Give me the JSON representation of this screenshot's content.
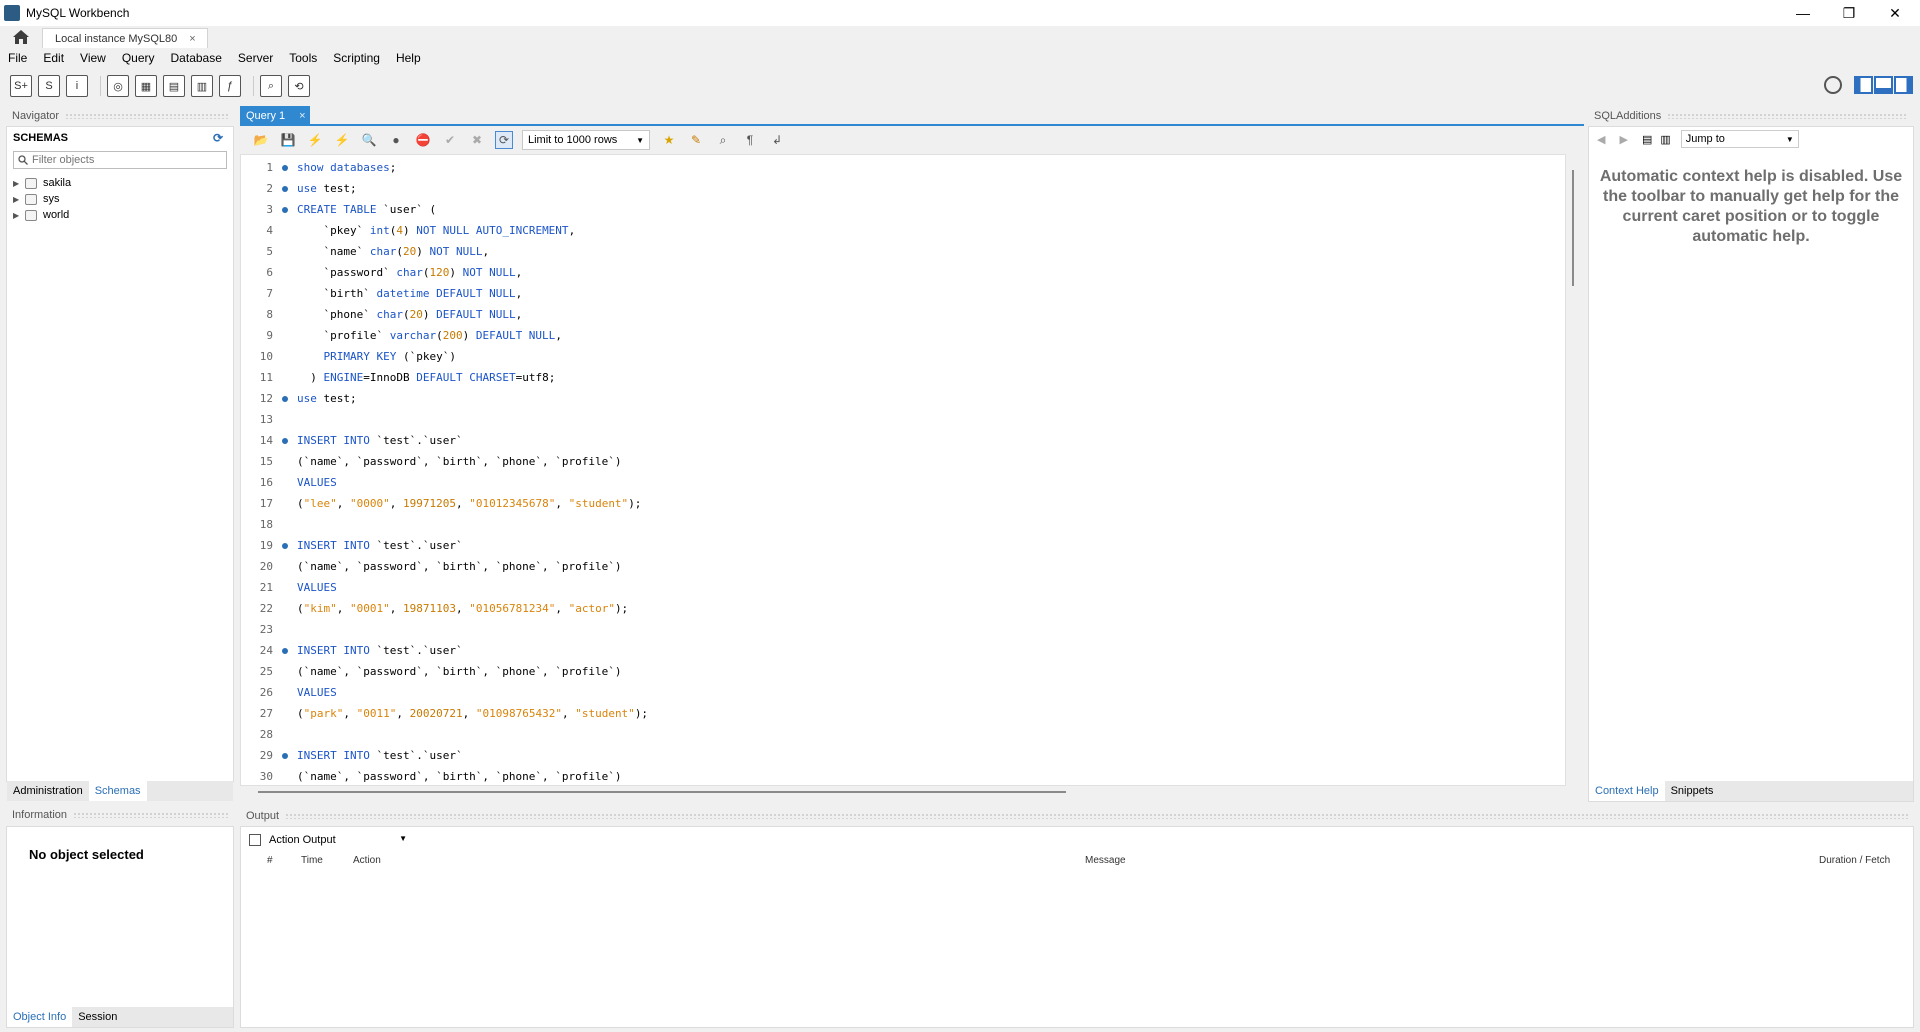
{
  "window": {
    "title": "MySQL Workbench",
    "min": "—",
    "max": "❐",
    "close": "✕"
  },
  "connection_tab": {
    "label": "Local instance MySQL80",
    "close": "×"
  },
  "menu": [
    "File",
    "Edit",
    "View",
    "Query",
    "Database",
    "Server",
    "Tools",
    "Scripting",
    "Help"
  ],
  "navigator": {
    "title": "Navigator",
    "schemas_header": "SCHEMAS",
    "filter_placeholder": "Filter objects",
    "schemas": [
      "sakila",
      "sys",
      "world"
    ],
    "tabs": [
      "Administration",
      "Schemas"
    ]
  },
  "editor": {
    "tab_label": "Query 1",
    "tab_close": "×",
    "limit_label": "Limit to 1000 rows",
    "lines": [
      [
        {
          "t": "show databases",
          "c": "kw"
        },
        {
          "t": ";",
          "c": "plain"
        }
      ],
      [
        {
          "t": "use",
          "c": "kw"
        },
        {
          "t": " test;",
          "c": "plain"
        }
      ],
      [
        {
          "t": "CREATE TABLE",
          "c": "kw"
        },
        {
          "t": " `user` (",
          "c": "plain"
        }
      ],
      [
        {
          "t": "    `pkey` ",
          "c": "plain"
        },
        {
          "t": "int",
          "c": "kw"
        },
        {
          "t": "(",
          "c": "plain"
        },
        {
          "t": "4",
          "c": "num"
        },
        {
          "t": ") ",
          "c": "plain"
        },
        {
          "t": "NOT NULL AUTO_INCREMENT",
          "c": "kw"
        },
        {
          "t": ",",
          "c": "plain"
        }
      ],
      [
        {
          "t": "    `name` ",
          "c": "plain"
        },
        {
          "t": "char",
          "c": "kw"
        },
        {
          "t": "(",
          "c": "plain"
        },
        {
          "t": "20",
          "c": "num"
        },
        {
          "t": ") ",
          "c": "plain"
        },
        {
          "t": "NOT NULL",
          "c": "kw"
        },
        {
          "t": ",",
          "c": "plain"
        }
      ],
      [
        {
          "t": "    `password` ",
          "c": "plain"
        },
        {
          "t": "char",
          "c": "kw"
        },
        {
          "t": "(",
          "c": "plain"
        },
        {
          "t": "120",
          "c": "num"
        },
        {
          "t": ") ",
          "c": "plain"
        },
        {
          "t": "NOT NULL",
          "c": "kw"
        },
        {
          "t": ",",
          "c": "plain"
        }
      ],
      [
        {
          "t": "    `birth` ",
          "c": "plain"
        },
        {
          "t": "datetime DEFAULT NULL",
          "c": "kw"
        },
        {
          "t": ",",
          "c": "plain"
        }
      ],
      [
        {
          "t": "    `phone` ",
          "c": "plain"
        },
        {
          "t": "char",
          "c": "kw"
        },
        {
          "t": "(",
          "c": "plain"
        },
        {
          "t": "20",
          "c": "num"
        },
        {
          "t": ") ",
          "c": "plain"
        },
        {
          "t": "DEFAULT NULL",
          "c": "kw"
        },
        {
          "t": ",",
          "c": "plain"
        }
      ],
      [
        {
          "t": "    `profile` ",
          "c": "plain"
        },
        {
          "t": "varchar",
          "c": "kw"
        },
        {
          "t": "(",
          "c": "plain"
        },
        {
          "t": "200",
          "c": "num"
        },
        {
          "t": ") ",
          "c": "plain"
        },
        {
          "t": "DEFAULT NULL",
          "c": "kw"
        },
        {
          "t": ",",
          "c": "plain"
        }
      ],
      [
        {
          "t": "    ",
          "c": "plain"
        },
        {
          "t": "PRIMARY KEY",
          "c": "kw"
        },
        {
          "t": " (`pkey`)",
          "c": "plain"
        }
      ],
      [
        {
          "t": "  ) ",
          "c": "plain"
        },
        {
          "t": "ENGINE",
          "c": "kw"
        },
        {
          "t": "=InnoDB ",
          "c": "plain"
        },
        {
          "t": "DEFAULT CHARSET",
          "c": "kw"
        },
        {
          "t": "=utf8;",
          "c": "plain"
        }
      ],
      [
        {
          "t": "use",
          "c": "kw"
        },
        {
          "t": " test;",
          "c": "plain"
        }
      ],
      [],
      [
        {
          "t": "INSERT INTO",
          "c": "kw"
        },
        {
          "t": " `test`.`user`",
          "c": "plain"
        }
      ],
      [
        {
          "t": "(`name`, `password`, `birth`, `phone`, `profile`)",
          "c": "plain"
        }
      ],
      [
        {
          "t": "VALUES",
          "c": "kw"
        }
      ],
      [
        {
          "t": "(",
          "c": "plain"
        },
        {
          "t": "\"lee\"",
          "c": "str"
        },
        {
          "t": ", ",
          "c": "plain"
        },
        {
          "t": "\"0000\"",
          "c": "str"
        },
        {
          "t": ", ",
          "c": "plain"
        },
        {
          "t": "19971205",
          "c": "num"
        },
        {
          "t": ", ",
          "c": "plain"
        },
        {
          "t": "\"01012345678\"",
          "c": "str"
        },
        {
          "t": ", ",
          "c": "plain"
        },
        {
          "t": "\"student\"",
          "c": "str"
        },
        {
          "t": ");",
          "c": "plain"
        }
      ],
      [],
      [
        {
          "t": "INSERT INTO",
          "c": "kw"
        },
        {
          "t": " `test`.`user`",
          "c": "plain"
        }
      ],
      [
        {
          "t": "(`name`, `password`, `birth`, `phone`, `profile`)",
          "c": "plain"
        }
      ],
      [
        {
          "t": "VALUES",
          "c": "kw"
        }
      ],
      [
        {
          "t": "(",
          "c": "plain"
        },
        {
          "t": "\"kim\"",
          "c": "str"
        },
        {
          "t": ", ",
          "c": "plain"
        },
        {
          "t": "\"0001\"",
          "c": "str"
        },
        {
          "t": ", ",
          "c": "plain"
        },
        {
          "t": "19871103",
          "c": "num"
        },
        {
          "t": ", ",
          "c": "plain"
        },
        {
          "t": "\"01056781234\"",
          "c": "str"
        },
        {
          "t": ", ",
          "c": "plain"
        },
        {
          "t": "\"actor\"",
          "c": "str"
        },
        {
          "t": ");",
          "c": "plain"
        }
      ],
      [],
      [
        {
          "t": "INSERT INTO",
          "c": "kw"
        },
        {
          "t": " `test`.`user`",
          "c": "plain"
        }
      ],
      [
        {
          "t": "(`name`, `password`, `birth`, `phone`, `profile`)",
          "c": "plain"
        }
      ],
      [
        {
          "t": "VALUES",
          "c": "kw"
        }
      ],
      [
        {
          "t": "(",
          "c": "plain"
        },
        {
          "t": "\"park\"",
          "c": "str"
        },
        {
          "t": ", ",
          "c": "plain"
        },
        {
          "t": "\"0011\"",
          "c": "str"
        },
        {
          "t": ", ",
          "c": "plain"
        },
        {
          "t": "20020721",
          "c": "num"
        },
        {
          "t": ", ",
          "c": "plain"
        },
        {
          "t": "\"01098765432\"",
          "c": "str"
        },
        {
          "t": ", ",
          "c": "plain"
        },
        {
          "t": "\"student\"",
          "c": "str"
        },
        {
          "t": ");",
          "c": "plain"
        }
      ],
      [],
      [
        {
          "t": "INSERT INTO",
          "c": "kw"
        },
        {
          "t": " `test`.`user`",
          "c": "plain"
        }
      ],
      [
        {
          "t": "(`name`, `password`, `birth`, `phone`, `profile`)",
          "c": "plain"
        }
      ]
    ],
    "dot_lines": [
      1,
      2,
      3,
      12,
      14,
      19,
      24,
      29
    ]
  },
  "sql_additions": {
    "title": "SQLAdditions",
    "jump_label": "Jump to",
    "help_text": "Automatic context help is disabled. Use the toolbar to manually get help for the current caret position or to toggle automatic help.",
    "tabs": [
      "Context Help",
      "Snippets"
    ]
  },
  "information": {
    "title": "Information",
    "no_object": "No object selected",
    "tabs": [
      "Object Info",
      "Session"
    ]
  },
  "output": {
    "title": "Output",
    "dropdown": "Action Output",
    "columns": [
      "#",
      "Time",
      "Action",
      "Message",
      "Duration / Fetch"
    ]
  },
  "colors": {
    "accent": "#2f88d0",
    "keyword": "#1b54c7",
    "number": "#c77a00",
    "string": "#d9840b"
  }
}
